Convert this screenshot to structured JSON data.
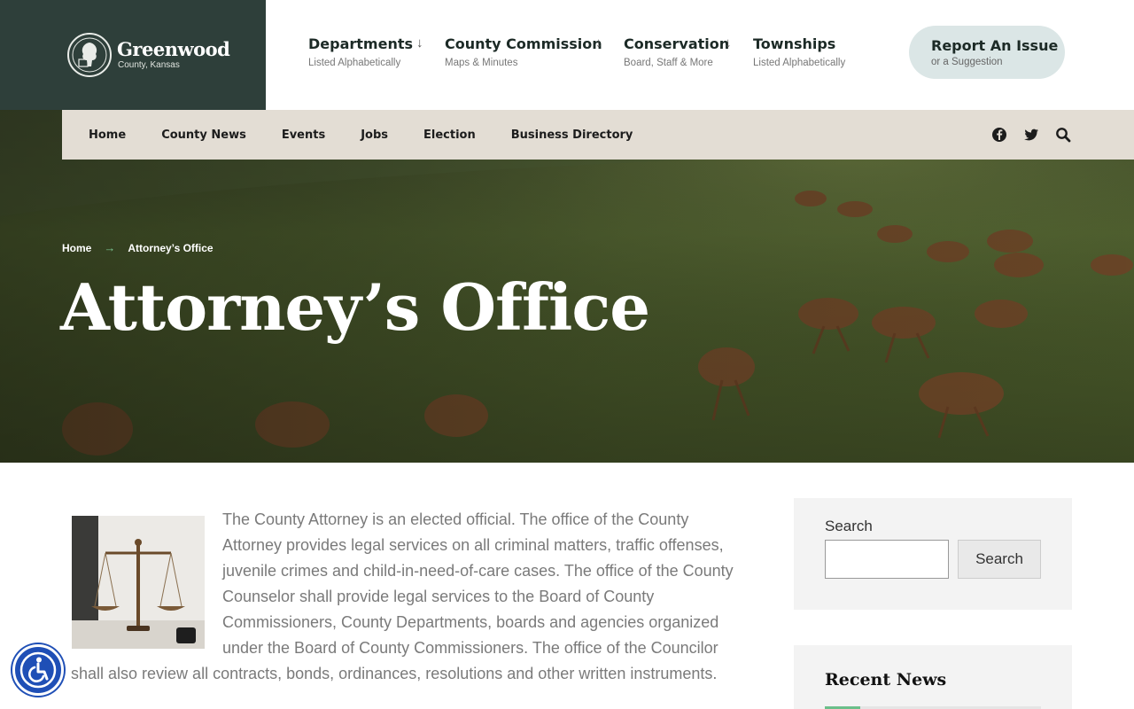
{
  "logo": {
    "name": "Greenwood",
    "subtitle": "County, Kansas"
  },
  "main_nav": [
    {
      "title": "Departments",
      "sub": "Listed Alphabetically",
      "arrow": "↓"
    },
    {
      "title": "County Commission",
      "sub": "Maps & Minutes",
      "arrow": "↓"
    },
    {
      "title": "Conservation",
      "sub": "Board, Staff & More",
      "arrow": "↓"
    },
    {
      "title": "Townships",
      "sub": "Listed Alphabetically",
      "arrow": ""
    }
  ],
  "report": {
    "title": "Report An Issue",
    "sub": "or a Suggestion"
  },
  "sub_nav": [
    "Home",
    "County News",
    "Events",
    "Jobs",
    "Election",
    "Business Directory"
  ],
  "social_icons": [
    "facebook-icon",
    "twitter-icon",
    "search-icon"
  ],
  "breadcrumb": {
    "home": "Home",
    "separator": "→",
    "current": "Attorney’s Office"
  },
  "page_title": "Attorney’s Office",
  "content": {
    "image_icon": "scales-of-justice",
    "text": "The County Attorney is an elected official. The office of the County Attorney provides legal services on all criminal matters, traffic offenses, juvenile crimes and child-in-need-of-care cases. The office of the County Counselor shall provide legal services to the Board of County Commissioners, County Departments, boards and agencies organized under the Board of County Commissioners. The office of the Councilor shall also review all contracts, bonds, ordinances, resolutions and other written instruments."
  },
  "sidebar": {
    "search_label": "Search",
    "search_button": "Search",
    "search_placeholder": "",
    "recent_news_title": "Recent News"
  },
  "colors": {
    "brand_dark": "#2e3f3a",
    "accent_green": "#6bbf8a",
    "subnav_bg": "#e3ddd4",
    "accessibility_blue": "#1f4fb6"
  }
}
